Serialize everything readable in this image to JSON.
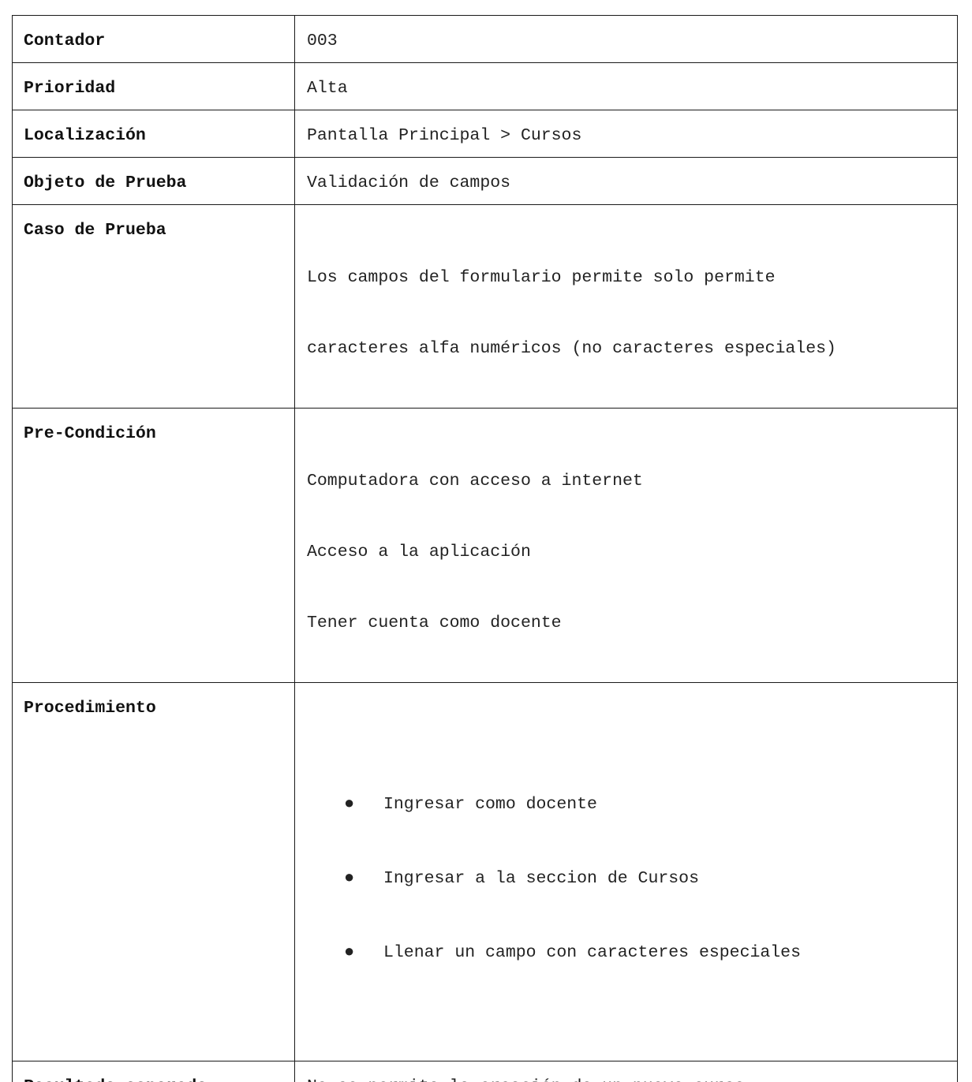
{
  "rows": [
    {
      "label": "Contador",
      "lines": [
        "003"
      ]
    },
    {
      "label": "Prioridad",
      "lines": [
        "Alta"
      ]
    },
    {
      "label": "Localización",
      "lines": [
        "Pantalla Principal > Cursos"
      ]
    },
    {
      "label": "Objeto de Prueba",
      "lines": [
        "Validación de campos"
      ]
    },
    {
      "label": "Caso de Prueba",
      "lines": [
        "Los campos del formulario permite solo permite",
        "caracteres alfa numéricos (no caracteres especiales)"
      ]
    },
    {
      "label": "Pre-Condición",
      "lines": [
        "Computadora con acceso a internet",
        "Acceso a la aplicación",
        "Tener cuenta como docente"
      ]
    },
    {
      "label": "Procedimiento",
      "bullet": "●",
      "steps": [
        "Ingresar como docente",
        "Ingresar a la seccion de Cursos",
        "Llenar un campo con caracteres especiales"
      ]
    },
    {
      "label": "Resultado esperado",
      "lines": [
        "No se permita la creación de un nuevo curso"
      ]
    }
  ]
}
